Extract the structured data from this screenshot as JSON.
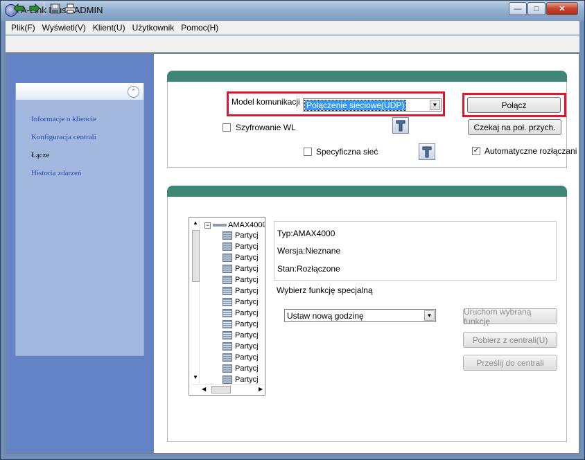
{
  "window": {
    "title": "A-Link Plus - ADMIN"
  },
  "menu": [
    "Plik(F)",
    "Wyświetl(V)",
    "Klient(U)",
    "Użytkownik",
    "Pomoc(H)"
  ],
  "sidebar": {
    "items": [
      {
        "label": "Informacje o kliencie"
      },
      {
        "label": "Konfiguracja centrali"
      },
      {
        "label": "Łącze"
      },
      {
        "label": "Historia zdarzeń"
      }
    ]
  },
  "connection": {
    "model_label": "Model komunikacji",
    "model_value": "Połączenie sieciowe(UDP)",
    "connect_label": "Połącz",
    "wait_label": "Czekaj na poł. przych.",
    "encryption_label": "Szyfrowanie WL",
    "encryption_checked": false,
    "specific_net_label": "Specyficzna sieć",
    "specific_net_checked": false,
    "auto_disconnect_label": "Automatyczne rozłączanie w",
    "auto_disconnect_checked": true
  },
  "tree": {
    "root": "AMAX4000",
    "children": [
      "Partycj",
      "Partycj",
      "Partycj",
      "Partycj",
      "Partycj",
      "Partycj",
      "Partycj",
      "Partycj",
      "Partycj",
      "Partycj",
      "Partycj",
      "Partycj",
      "Partycj",
      "Partycj"
    ]
  },
  "device_info": {
    "type": "Typ:AMAX4000",
    "version": "Wersja:Nieznane",
    "status": "Stan:Rozłączone"
  },
  "special": {
    "label": "Wybierz funkcję specjalną",
    "selected": "Ustaw nową godzinę",
    "run_label": "Uruchom wybraną funkcję",
    "fetch_label": "Pobierz z centrali(U)",
    "send_label": "Prześlij do centrali"
  },
  "colors": {
    "accent_red": "#e0172c",
    "panel_header": "#3f8774",
    "sidebar": "#6383c6"
  }
}
